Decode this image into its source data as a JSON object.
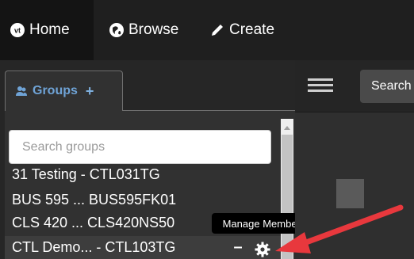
{
  "nav": {
    "home": {
      "label": "Home",
      "icon": "vt-logo-icon"
    },
    "browse": {
      "label": "Browse",
      "icon": "globe-icon"
    },
    "create": {
      "label": "Create",
      "icon": "pencil-icon"
    }
  },
  "groups_tab": {
    "label": "Groups",
    "add": "+",
    "icon": "user-group-icon"
  },
  "search": {
    "placeholder": "Search groups"
  },
  "groups": [
    {
      "label": "31 Testing - CTL031TG"
    },
    {
      "label": "BUS 595 ... BUS595FK01"
    },
    {
      "label": "CLS 420 ... CLS420NS50"
    },
    {
      "label": "CTL Demo... - CTL103TG"
    }
  ],
  "selected_row": {
    "remove": "–",
    "manage_icon": "gear-icon"
  },
  "tooltip": {
    "text": "Manage Members"
  },
  "right": {
    "search_label": "Search",
    "menu_icon": "hamburger-icon"
  },
  "colors": {
    "accent": "#6fa3d6",
    "arrow": "#e8383d"
  }
}
